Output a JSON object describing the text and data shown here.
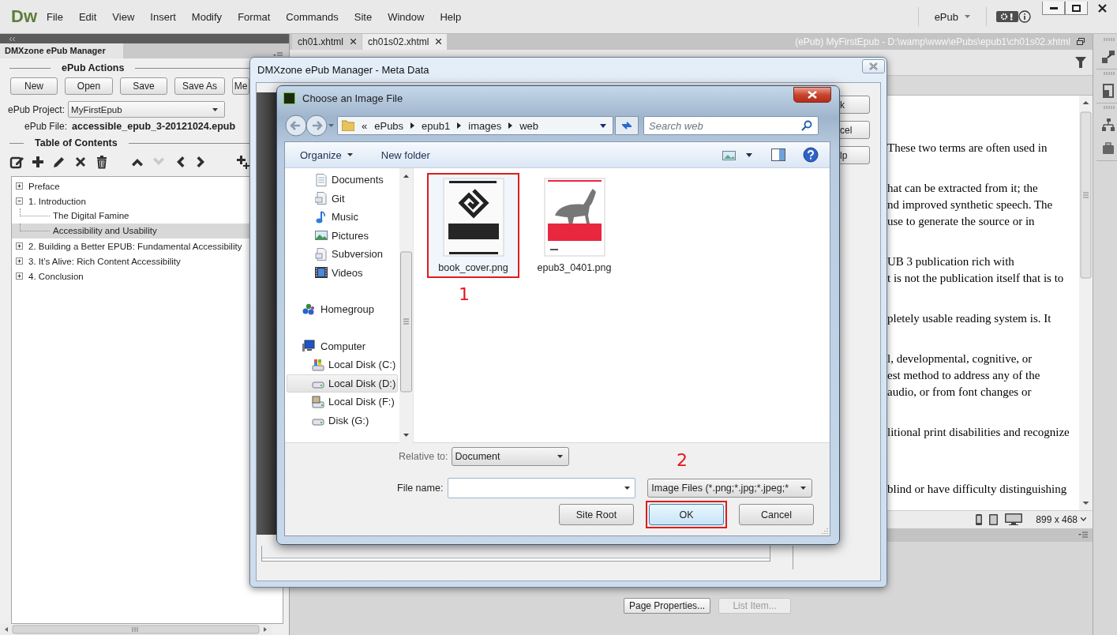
{
  "app": {
    "logo": "Dw",
    "menu": [
      "File",
      "Edit",
      "View",
      "Insert",
      "Modify",
      "Format",
      "Commands",
      "Site",
      "Window",
      "Help"
    ],
    "workspace": "ePub"
  },
  "left_panel": {
    "tab": "DMXzone ePub Manager",
    "actions_title": "ePub Actions",
    "action_buttons": [
      "New",
      "Open",
      "Save",
      "Save As",
      "Me"
    ],
    "project_label": "ePub Project:",
    "project_value": "MyFirstEpub",
    "file_label": "ePub File:",
    "file_value": "accessible_epub_3-20121024.epub",
    "toc_title": "Table of Contents",
    "toc_tools": [
      {
        "kind": "edit",
        "disabled": false
      },
      {
        "kind": "add",
        "disabled": false
      },
      {
        "kind": "pencil",
        "disabled": false
      },
      {
        "kind": "delete",
        "disabled": false
      },
      {
        "kind": "trash",
        "disabled": false
      },
      {
        "kind": "up",
        "disabled": false
      },
      {
        "kind": "down",
        "disabled": true
      },
      {
        "kind": "left",
        "disabled": false
      },
      {
        "kind": "right",
        "disabled": false
      },
      {
        "kind": "add-child",
        "disabled": false
      }
    ],
    "toc": [
      {
        "label": "Preface",
        "expanded": false,
        "selected": false
      },
      {
        "label": "1. Introduction",
        "expanded": true,
        "selected": false,
        "children": [
          {
            "label": "The Digital Famine",
            "selected": false
          },
          {
            "label": "Accessibility and Usability",
            "selected": true
          }
        ]
      },
      {
        "label": "2. Building a Better EPUB: Fundamental Accessibility",
        "expanded": false,
        "selected": false
      },
      {
        "label": "3. It’s Alive: Rich Content Accessibility",
        "expanded": false,
        "selected": false
      },
      {
        "label": "4. Conclusion",
        "expanded": false,
        "selected": false
      }
    ]
  },
  "document": {
    "tabs": [
      {
        "label": "ch01.xhtml",
        "selected": false
      },
      {
        "label": "ch01s02.xhtml",
        "selected": true
      }
    ],
    "path": "(ePub) MyFirstEpub - D:\\wamp\\www\\ePubs\\epub1\\ch01s02.xhtml",
    "paragraphs": [
      {
        "lines": [
          "These two terms are often used in"
        ]
      },
      {
        "lines": [
          "hat can be extracted from it; the",
          "nd improved synthetic speech. The",
          "use to generate the source or in"
        ]
      },
      {
        "lines": [
          "UB 3 publication rich with",
          "t is not the publication itself that is to"
        ]
      },
      {
        "lines": [
          "pletely usable reading system is. It"
        ]
      },
      {
        "lines": [
          "l, developmental, cognitive, or",
          "est method to address any of the",
          "audio, or from font changes or"
        ]
      },
      {
        "lines": [
          "litional print disabilities and recognize"
        ]
      },
      {
        "lines": [
          "blind or have difficulty distinguishing"
        ]
      }
    ],
    "window_size": "899 x 468"
  },
  "properties": {
    "buttons": [
      {
        "label": "Page Properties...",
        "disabled": false
      },
      {
        "label": "List Item...",
        "disabled": true
      }
    ]
  },
  "meta_dialog": {
    "title": "DMXzone ePub Manager - Meta Data",
    "buttons": [
      "k",
      "cel",
      "lp"
    ]
  },
  "file_dialog": {
    "title": "Choose an Image File",
    "breadcrumb_prefix": "«",
    "breadcrumb": [
      "ePubs",
      "epub1",
      "images",
      "web"
    ],
    "search": {
      "placeholder": "Search web"
    },
    "organize": "Organize",
    "new_folder": "New folder",
    "nav_libraries": [
      {
        "label": "Documents",
        "kind": "documents",
        "selected": false
      },
      {
        "label": "Git",
        "kind": "git",
        "selected": false
      },
      {
        "label": "Music",
        "kind": "music",
        "selected": false
      },
      {
        "label": "Pictures",
        "kind": "pictures",
        "selected": false
      },
      {
        "label": "Subversion",
        "kind": "subversion",
        "selected": false
      },
      {
        "label": "Videos",
        "kind": "videos",
        "selected": false
      }
    ],
    "nav_groups": [
      {
        "label": "Homegroup",
        "kind": "homegroup",
        "selected": false
      },
      {
        "label": "Computer",
        "kind": "computer",
        "selected": false,
        "children": [
          {
            "label": "Local Disk (C:)",
            "kind": "disk-windows",
            "selected": false
          },
          {
            "label": "Local Disk (D:)",
            "kind": "disk",
            "selected": true
          },
          {
            "label": "Local Disk (F:)",
            "kind": "disk-photo",
            "selected": false
          },
          {
            "label": "Disk (G:)",
            "kind": "disk",
            "selected": false
          }
        ]
      }
    ],
    "files": [
      {
        "name": "book_cover.png",
        "kind": "epub-cover",
        "selected": true,
        "highlighted": true
      },
      {
        "name": "epub3_0401.png",
        "kind": "book-photo",
        "selected": false,
        "highlighted": false
      }
    ],
    "relative_label": "Relative to:",
    "relative_value": "Document",
    "file_name_label": "File name:",
    "file_type": "Image Files (*.png;*.jpg;*.jpeg;*",
    "buttons": [
      {
        "label": "Site Root",
        "highlighted": false
      },
      {
        "label": "OK",
        "highlighted": true
      },
      {
        "label": "Cancel",
        "highlighted": false
      }
    ]
  },
  "annotations": [
    "1",
    "2"
  ]
}
